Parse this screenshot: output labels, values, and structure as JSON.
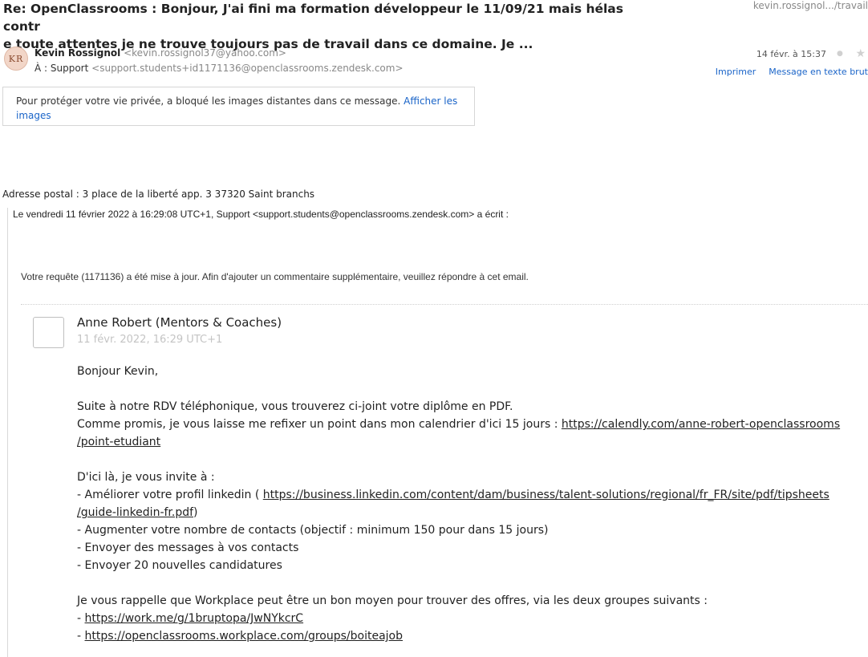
{
  "message": {
    "subject": "Re: OpenClassrooms : Bonjour, J'ai fini ma formation développeur le 11/09/21 mais hélas contre toute attentes je ne trouve toujours pas de travail dans ce domaine. Je ...",
    "subject_line1": "Re: OpenClassrooms : Bonjour, J'ai fini ma formation développeur le 11/09/21 mais hélas contr",
    "subject_line2": "e toute attentes je ne trouve toujours pas de travail dans ce domaine. Je ...",
    "folder": "kevin.rossignol.../travail",
    "avatar_initials": "KR",
    "sender_name": "Kevin Rossignol",
    "sender_email": "<kevin.rossignol37@yahoo.com>",
    "to_label": "À : Support",
    "to_email": "<support.students+id1171136@openclassrooms.zendesk.com>",
    "date": "14 févr. à 15:37",
    "print_label": "Imprimer",
    "plain_text_label": "Message en texte brut"
  },
  "privacy": {
    "text": "Pour protéger votre vie privée, a bloqué les images distantes dans ce message.",
    "link": "Afficher les",
    "link2": "images"
  },
  "body": {
    "address": "Adresse postal : 3 place de la liberté app. 3 37320 Saint branchs",
    "wrote_line": "Le vendredi 11 février 2022 à 16:29:08 UTC+1, Support <support.students@openclassrooms.zendesk.com> a écrit :",
    "update_line": "Votre requête (1171136) a été mise à jour. Afin d'ajouter un commentaire supplémentaire, veuillez répondre à cet email."
  },
  "mentor": {
    "name": "Anne Robert (Mentors & Coaches)",
    "date": "11 févr. 2022, 16:29 UTC+1",
    "greeting": "Bonjour Kevin,",
    "line1": "Suite à notre RDV téléphonique, vous trouverez ci-joint votre diplôme en PDF.",
    "line2": "Comme promis, je vous laisse me refixer un point dans mon calendrier d'ici 15 jours : ",
    "calendly_link": "https://calendly.com/anne-robert-openclassrooms",
    "calendly_link2": "/point-etudiant",
    "invite": "D'ici là, je vous invite à :",
    "item1_prefix": "- Améliorer votre profil linkedin ( ",
    "linkedin_link": "https://business.linkedin.com/content/dam/business/talent-solutions/regional/fr_FR/site/pdf/tipsheets",
    "linkedin_link2": "/guide-linkedin-fr.pdf",
    "item1_suffix": ")",
    "item2": "- Augmenter votre nombre de contacts (objectif : minimum 150 pour dans 15 jours)",
    "item3": "- Envoyer des messages à vos contacts",
    "item4": "- Envoyer 20 nouvelles candidatures",
    "workplace_intro": "Je vous rappelle que Workplace peut être un bon moyen pour trouver des offres, via les deux groupes suivants :",
    "group1_prefix": "- ",
    "group1_link": "https://work.me/g/1bruptopa/JwNYkcrC",
    "group2_prefix": "- ",
    "group2_link": "https://openclassrooms.workplace.com/groups/boiteajob"
  }
}
